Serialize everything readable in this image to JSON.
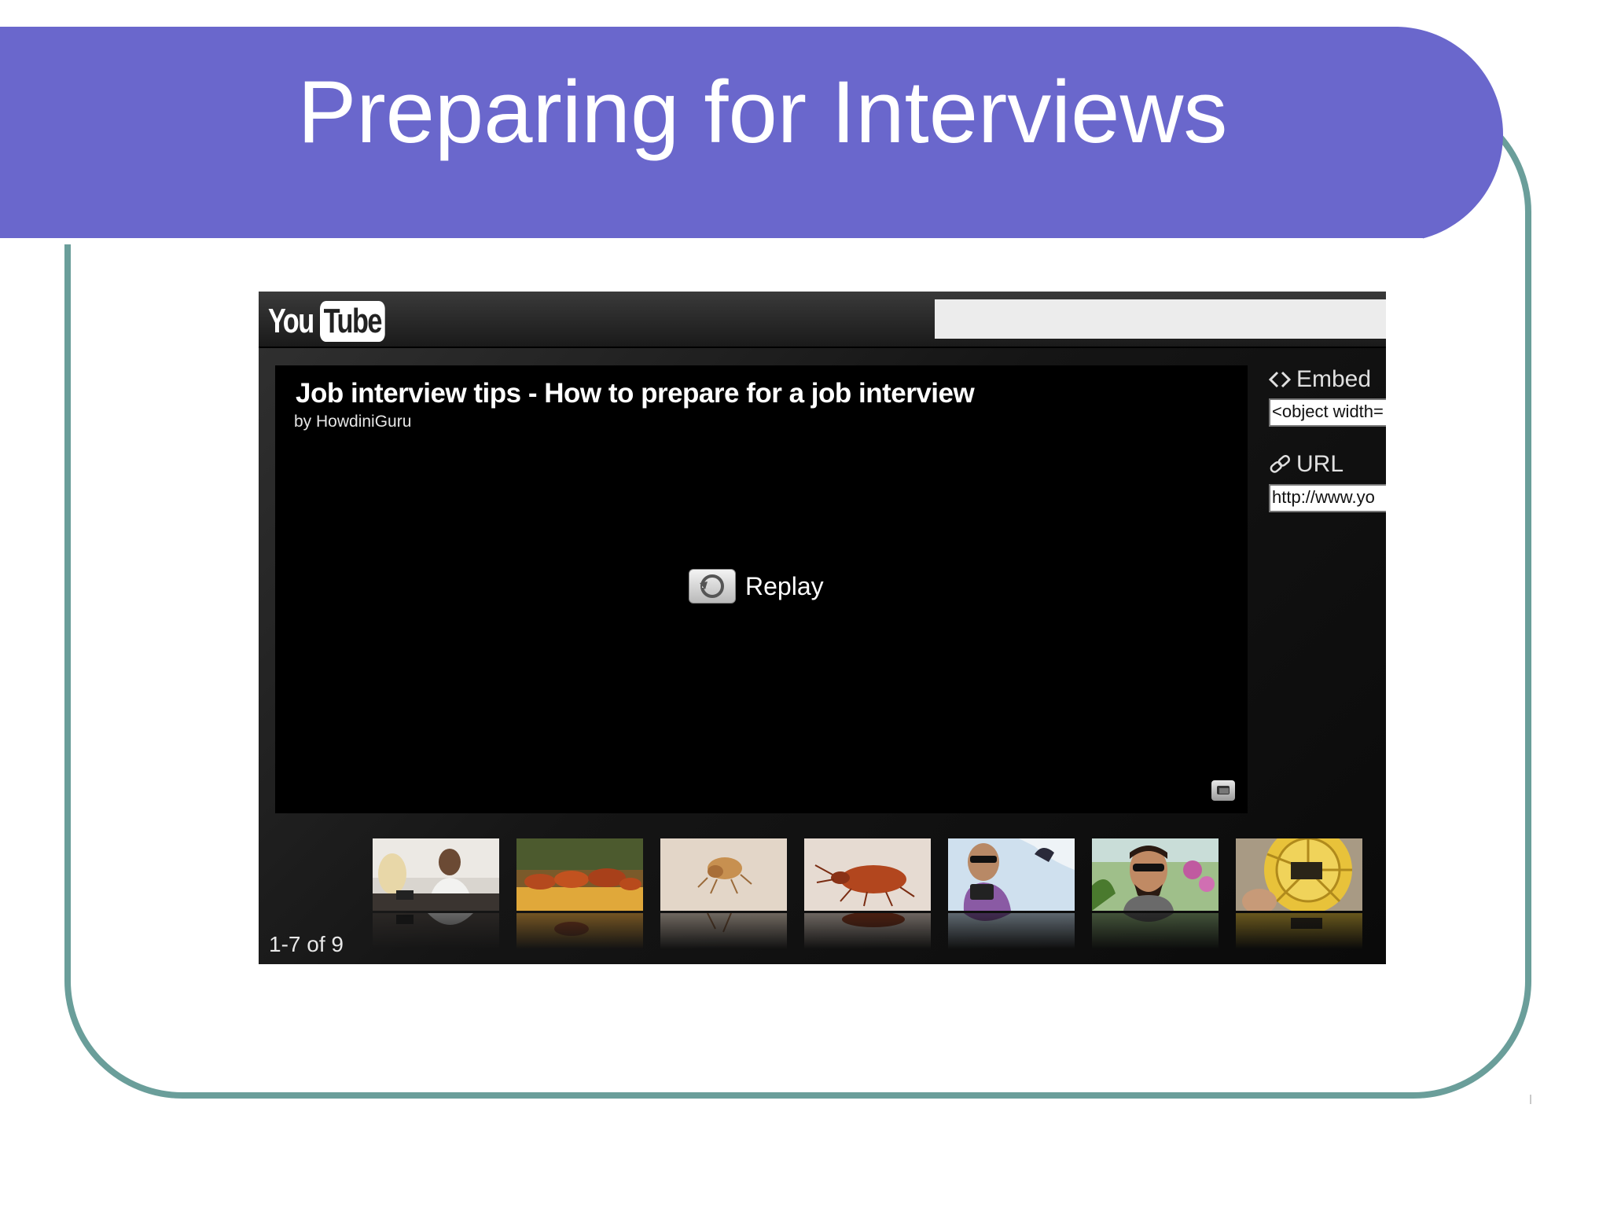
{
  "slide": {
    "title": "Preparing for Interviews"
  },
  "player": {
    "logo": {
      "you": "You",
      "tube": "Tube"
    },
    "search": {
      "value": ""
    },
    "video": {
      "title": "Job interview tips - How to prepare for a job interview",
      "by": "by HowdiniGuru"
    },
    "replay_label": "Replay",
    "embed": {
      "label": "Embed",
      "value": "<object width="
    },
    "url": {
      "label": "URL",
      "value": "http://www.yo"
    },
    "count": "1-7 of 9",
    "thumbnails": [
      {
        "icon": "interview-thumbnail"
      },
      {
        "icon": "insects-thumbnail"
      },
      {
        "icon": "bug-thumbnail"
      },
      {
        "icon": "bedbug-thumbnail"
      },
      {
        "icon": "man-with-camera-thumbnail"
      },
      {
        "icon": "smiling-man-thumbnail"
      },
      {
        "icon": "yellow-wheel-thumbnail"
      }
    ]
  },
  "colors": {
    "title_bar": "#6a67cc",
    "frame_border": "#6a9e9a",
    "player_bg": "#0c0c0c"
  }
}
